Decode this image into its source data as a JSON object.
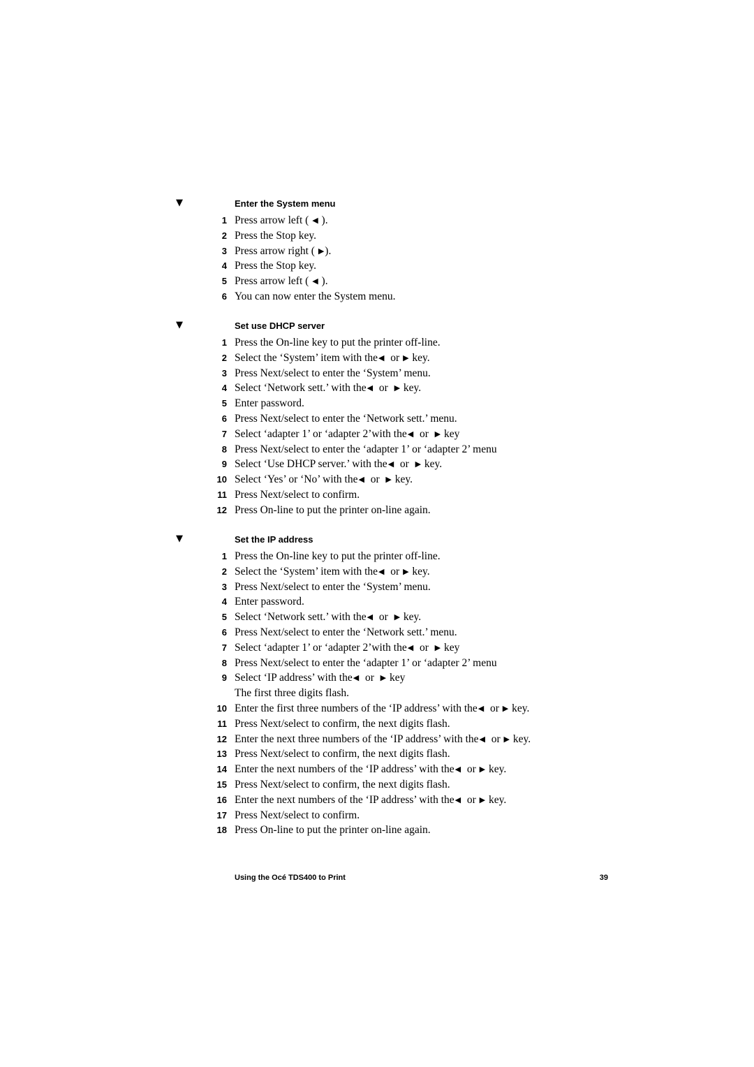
{
  "sections": [
    {
      "marker": "▼",
      "title": "Enter the System menu",
      "steps": [
        {
          "num": "1",
          "segments": [
            {
              "t": "Press arrow left ( "
            },
            {
              "a": "left"
            },
            {
              "t": " )."
            }
          ]
        },
        {
          "num": "2",
          "segments": [
            {
              "t": "Press the Stop key."
            }
          ]
        },
        {
          "num": "3",
          "segments": [
            {
              "t": "Press arrow right ( "
            },
            {
              "a": "right"
            },
            {
              "t": ")."
            }
          ]
        },
        {
          "num": "4",
          "segments": [
            {
              "t": "Press the Stop key."
            }
          ]
        },
        {
          "num": "5",
          "segments": [
            {
              "t": "Press arrow left ( "
            },
            {
              "a": "left"
            },
            {
              "t": " )."
            }
          ]
        },
        {
          "num": "6",
          "segments": [
            {
              "t": "You can now enter the System menu."
            }
          ]
        }
      ]
    },
    {
      "marker": "▼",
      "title": "Set use DHCP server",
      "steps": [
        {
          "num": "1",
          "segments": [
            {
              "t": "Press the On-line key to put the printer off-line."
            }
          ]
        },
        {
          "num": "2",
          "segments": [
            {
              "t": "Select the ‘System’ item with the"
            },
            {
              "a": "left"
            },
            {
              "t": "  or "
            },
            {
              "a": "right"
            },
            {
              "t": " key."
            }
          ]
        },
        {
          "num": "3",
          "segments": [
            {
              "t": "Press Next/select to enter the ‘System’ menu."
            }
          ]
        },
        {
          "num": "4",
          "segments": [
            {
              "t": "Select ‘Network sett.’ with the"
            },
            {
              "a": "left"
            },
            {
              "t": "  or  "
            },
            {
              "a": "right"
            },
            {
              "t": " key."
            }
          ]
        },
        {
          "num": "5",
          "segments": [
            {
              "t": "Enter password."
            }
          ]
        },
        {
          "num": "6",
          "segments": [
            {
              "t": "Press Next/select to enter the ‘Network sett.’ menu."
            }
          ]
        },
        {
          "num": "7",
          "segments": [
            {
              "t": "Select ‘adapter 1’ or ‘adapter 2’with the"
            },
            {
              "a": "left"
            },
            {
              "t": "  or  "
            },
            {
              "a": "right"
            },
            {
              "t": " key"
            }
          ]
        },
        {
          "num": "8",
          "segments": [
            {
              "t": "Press Next/select to enter the ‘adapter 1’ or ‘adapter 2’ menu"
            }
          ]
        },
        {
          "num": "9",
          "segments": [
            {
              "t": "Select ‘Use DHCP server.’ with the"
            },
            {
              "a": "left"
            },
            {
              "t": "  or  "
            },
            {
              "a": "right"
            },
            {
              "t": " key."
            }
          ]
        },
        {
          "num": "10",
          "segments": [
            {
              "t": "Select ‘Yes’ or ‘No’ with the"
            },
            {
              "a": "left"
            },
            {
              "t": "  or  "
            },
            {
              "a": "right"
            },
            {
              "t": " key."
            }
          ]
        },
        {
          "num": "11",
          "segments": [
            {
              "t": "Press Next/select to confirm."
            }
          ]
        },
        {
          "num": "12",
          "segments": [
            {
              "t": "Press On-line to put the printer on-line again."
            }
          ]
        }
      ]
    },
    {
      "marker": "▼",
      "title": "Set the IP address",
      "steps": [
        {
          "num": "1",
          "segments": [
            {
              "t": "Press the On-line key to put the printer off-line."
            }
          ]
        },
        {
          "num": "2",
          "segments": [
            {
              "t": "Select the ‘System’ item with the"
            },
            {
              "a": "left"
            },
            {
              "t": "  or "
            },
            {
              "a": "right"
            },
            {
              "t": " key."
            }
          ]
        },
        {
          "num": "3",
          "segments": [
            {
              "t": "Press Next/select to enter the ‘System’ menu."
            }
          ]
        },
        {
          "num": "4",
          "segments": [
            {
              "t": "Enter password."
            }
          ]
        },
        {
          "num": "5",
          "segments": [
            {
              "t": "Select ‘Network sett.’ with the"
            },
            {
              "a": "left"
            },
            {
              "t": "  or  "
            },
            {
              "a": "right"
            },
            {
              "t": " key."
            }
          ]
        },
        {
          "num": "6",
          "segments": [
            {
              "t": "Press Next/select to enter the ‘Network sett.’ menu."
            }
          ]
        },
        {
          "num": "7",
          "segments": [
            {
              "t": "Select ‘adapter 1’ or ‘adapter 2’with the"
            },
            {
              "a": "left"
            },
            {
              "t": "  or  "
            },
            {
              "a": "right"
            },
            {
              "t": " key"
            }
          ]
        },
        {
          "num": "8",
          "segments": [
            {
              "t": "Press Next/select to enter the ‘adapter 1’ or ‘adapter 2’ menu"
            }
          ]
        },
        {
          "num": "9",
          "segments": [
            {
              "t": "Select ‘IP address’ with the"
            },
            {
              "a": "left"
            },
            {
              "t": "  or  "
            },
            {
              "a": "right"
            },
            {
              "t": " key"
            }
          ]
        },
        {
          "num": "",
          "segments": [
            {
              "t": "The first three digits flash."
            }
          ]
        },
        {
          "num": "10",
          "segments": [
            {
              "t": "Enter the first three numbers of the ‘IP address’ with the"
            },
            {
              "a": "left"
            },
            {
              "t": "  or "
            },
            {
              "a": "right"
            },
            {
              "t": " key."
            }
          ]
        },
        {
          "num": "11",
          "segments": [
            {
              "t": "Press Next/select to confirm, the next digits flash."
            }
          ]
        },
        {
          "num": "12",
          "segments": [
            {
              "t": "Enter the next three numbers of the ‘IP address’ with the"
            },
            {
              "a": "left"
            },
            {
              "t": "  or "
            },
            {
              "a": "right"
            },
            {
              "t": " key."
            }
          ]
        },
        {
          "num": "13",
          "segments": [
            {
              "t": "Press Next/select to confirm, the next digits flash."
            }
          ]
        },
        {
          "num": "14",
          "segments": [
            {
              "t": "Enter the next numbers of the ‘IP address’ with the"
            },
            {
              "a": "left"
            },
            {
              "t": "  or "
            },
            {
              "a": "right"
            },
            {
              "t": " key."
            }
          ]
        },
        {
          "num": "15",
          "segments": [
            {
              "t": "Press Next/select to confirm, the next digits flash."
            }
          ]
        },
        {
          "num": "16",
          "segments": [
            {
              "t": "Enter the next numbers of the ‘IP address’ with the"
            },
            {
              "a": "left"
            },
            {
              "t": "  or "
            },
            {
              "a": "right"
            },
            {
              "t": " key."
            }
          ]
        },
        {
          "num": "17",
          "segments": [
            {
              "t": "Press Next/select to confirm."
            }
          ]
        },
        {
          "num": "18",
          "segments": [
            {
              "t": "Press On-line to put the printer on-line again."
            }
          ]
        }
      ]
    }
  ],
  "icons": {
    "left": "◀",
    "right": "▶"
  },
  "footer": {
    "title": "Using the Océ TDS400 to Print",
    "page_number": "39"
  }
}
